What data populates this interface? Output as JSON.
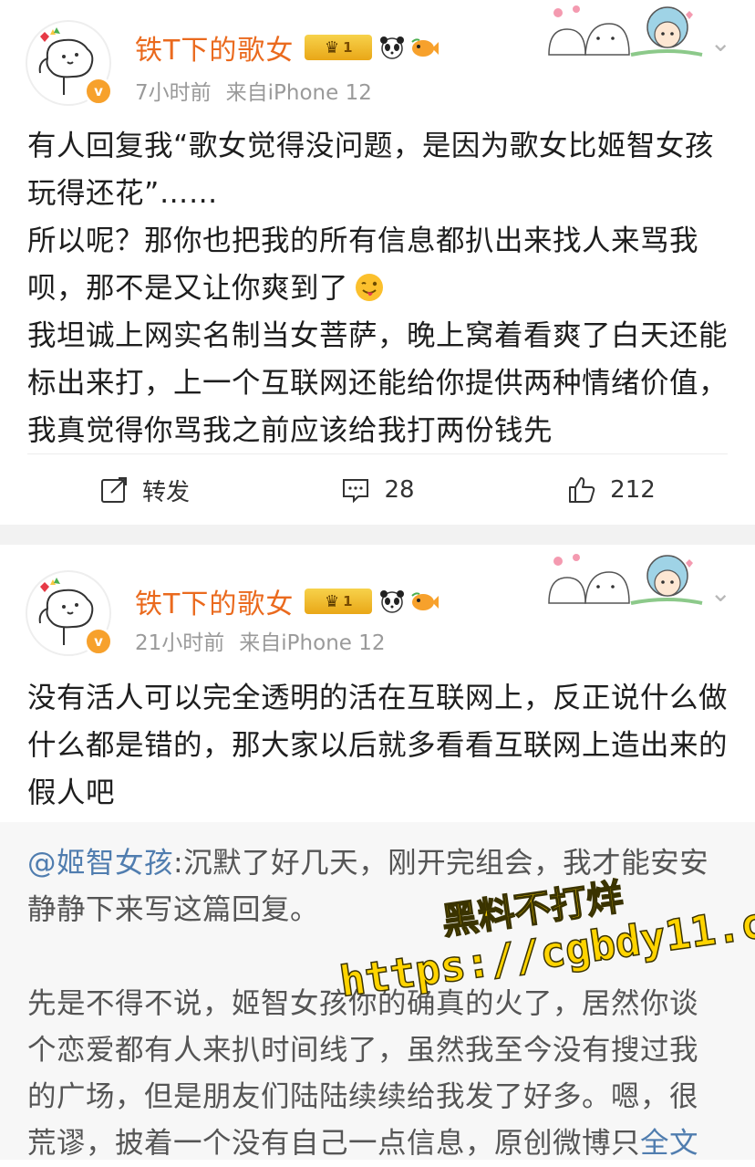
{
  "posts": [
    {
      "username": "铁T下的歌女",
      "badge_level": "1",
      "time": "7小时前",
      "source": "来自iPhone 12",
      "paragraphs": [
        "有人回复我“歌女觉得没问题，是因为歌女比姬智女孩玩得还花”……",
        "所以呢？那你也把我的所有信息都扒出来找人来骂我呗，那不是又让你爽到了",
        "我坦诚上网实名制当女菩萨，晚上窝着看爽了白天还能标出来打，上一个互联网还能给你提供两种情绪价值，我真觉得你骂我之前应该给我打两份钱先"
      ],
      "actions": {
        "repost_label": "转发",
        "comments": "28",
        "likes": "212"
      }
    },
    {
      "username": "铁T下的歌女",
      "badge_level": "1",
      "time": "21小时前",
      "source": "来自iPhone 12",
      "paragraphs": [
        "没有活人可以完全透明的活在互联网上，反正说什么做什么都是错的，那大家以后就多看看互联网上造出来的假人吧"
      ],
      "quote": {
        "mention": "@姬智女孩",
        "para1": ":沉默了好几天，刚开完组会，我才能安安静静下来写这篇回复。",
        "para2": "先是不得不说，姬智女孩你的确真的火了，居然你谈个恋爱都有人来扒时间线了，虽然我至今没有搜过我的广场，但是朋友们陆陆续续给我发了好多。嗯，很荒谬，披着一个没有自己一点信息，原创微博只",
        "fulltext": "全文"
      }
    }
  ],
  "watermark": {
    "line1": "黑料不打烊",
    "line2": "https://cgbdy11.com"
  },
  "colors": {
    "username": "#ea6a1e",
    "link": "#507daf",
    "meta": "#9a9a9a"
  }
}
